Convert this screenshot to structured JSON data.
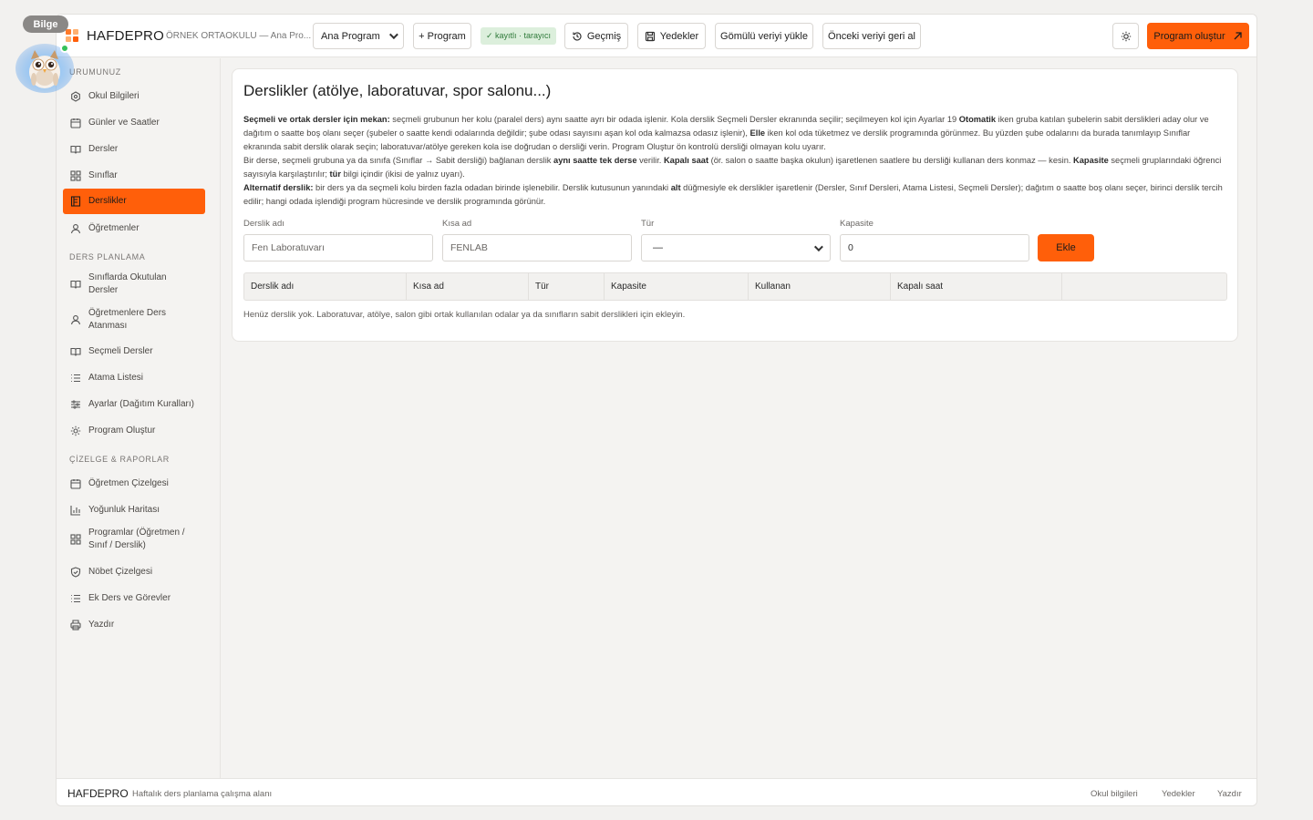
{
  "topbar": {
    "brand": "HAFDEPRO",
    "school": "ÖRNEK ORTAOKULU — Ana Pro...",
    "program_select": "Ana Program",
    "new_program": "+ Program",
    "status_badge": "✓ kayıtlı · tarayıcı",
    "history": "Geçmiş",
    "backups": "Yedekler",
    "load_embedded": "Gömülü veriyi yükle",
    "restore_previous": "Önceki veriyi geri al",
    "create_program": "Program oluştur"
  },
  "mascot": {
    "name": "Bilge"
  },
  "sidebar": {
    "section1": "URUMUNUZ",
    "items1": [
      {
        "label": "Okul Bilgileri",
        "icon": "gear-icon"
      },
      {
        "label": "Günler ve Saatler",
        "icon": "calendar-icon"
      },
      {
        "label": "Dersler",
        "icon": "book-icon"
      },
      {
        "label": "Sınıflar",
        "icon": "grid-icon"
      },
      {
        "label": "Derslikler",
        "icon": "room-icon"
      },
      {
        "label": "Öğretmenler",
        "icon": "user-icon"
      }
    ],
    "section2": "DERS PLANLAMA",
    "items2": [
      {
        "label": "Sınıflarda Okutulan Dersler",
        "icon": "book-icon"
      },
      {
        "label": "Öğretmenlere Ders Atanması",
        "icon": "user-icon"
      },
      {
        "label": "Seçmeli Dersler",
        "icon": "book-icon"
      },
      {
        "label": "Atama Listesi",
        "icon": "list-icon"
      },
      {
        "label": "Ayarlar (Dağıtım Kuralları)",
        "icon": "sliders-icon"
      },
      {
        "label": "Program Oluştur",
        "icon": "cog-icon"
      }
    ],
    "section3": "ÇİZELGE & RAPORLAR",
    "items3": [
      {
        "label": "Öğretmen Çizelgesi",
        "icon": "calendar-icon"
      },
      {
        "label": "Yoğunluk Haritası",
        "icon": "bar-chart-icon"
      },
      {
        "label": "Programlar (Öğretmen / Sınıf / Derslik)",
        "icon": "grid-icon"
      },
      {
        "label": "Nöbet Çizelgesi",
        "icon": "shield-icon"
      },
      {
        "label": "Ek Ders ve Görevler",
        "icon": "list-icon"
      },
      {
        "label": "Yazdır",
        "icon": "printer-icon"
      }
    ]
  },
  "main": {
    "title": "Derslikler (atölye, laboratuvar, spor salonu...)",
    "p1_bold": "Seçmeli ve ortak dersler için mekan:",
    "p1_a": " seçmeli grubunun her kolu (paralel ders) aynı saatte ayrı bir odada işlenir. Kola derslik Seçmeli Dersler ekranında seçilir; seçilmeyen kol için Ayarlar 19 ",
    "p1_b1": "Otomatik",
    "p1_b": " iken gruba katılan şubelerin sabit derslikleri aday olur ve dağıtım o saatte boş olanı seçer (şubeler o saatte kendi odalarında değildir; şube odası sayısını aşan kol oda kalmazsa odasız işlenir), ",
    "p1_b2": "Elle",
    "p1_c": " iken kol oda tüketmez ve derslik programında görünmez. Bu yüzden şube odalarını da burada tanımlayıp Sınıflar ekranında sabit derslik olarak seçin; laboratuvar/atölye gereken kola ise doğrudan o dersliği verin. Program Oluştur ön kontrolü dersliği olmayan kolu uyarır.",
    "p2_a": "Bir derse, seçmeli grubuna ya da sınıfa (Sınıflar → Sabit dersliği) bağlanan derslik ",
    "p2_b1": "aynı saatte tek derse",
    "p2_b": " verilir. ",
    "p2_b2": "Kapalı saat",
    "p2_c": " (ör. salon o saatte başka okulun) işaretlenen saatlere bu dersliği kullanan ders konmaz — kesin. ",
    "p2_b3": "Kapasite",
    "p2_d": " seçmeli gruplarındaki öğrenci sayısıyla karşılaştırılır; ",
    "p2_b4": "tür",
    "p2_e": " bilgi içindir (ikisi de yalnız uyarı).",
    "p3_bold": "Alternatif derslik:",
    "p3_a": " bir ders ya da seçmeli kolu birden fazla odadan birinde işlenebilir. Derslik kutusunun yanındaki ",
    "p3_b1": "alt",
    "p3_b": " düğmesiyle ek derslikler işaretlenir (Dersler, Sınıf Dersleri, Atama Listesi, Seçmeli Dersler); dağıtım o saatte boş olanı seçer, birinci derslik tercih edilir; hangi odada işlendiği program hücresinde ve derslik programında görünür.",
    "form": {
      "name_label": "Derslik adı",
      "name_placeholder": "Fen Laboratuvarı",
      "short_label": "Kısa ad",
      "short_placeholder": "FENLAB",
      "type_label": "Tür",
      "type_value": "—",
      "capacity_label": "Kapasite",
      "capacity_value": "0",
      "add_button": "Ekle"
    },
    "table_headers": [
      "Derslik adı",
      "Kısa ad",
      "Tür",
      "Kapasite",
      "Kullanan",
      "Kapalı saat",
      ""
    ],
    "empty_text": "Henüz derslik yok. Laboratuvar, atölye, salon gibi ortak kullanılan odalar ya da sınıfların sabit derslikleri için ekleyin."
  },
  "footer": {
    "brand": "HAFDEPRO",
    "tagline": "Haftalık ders planlama çalışma alanı",
    "links": [
      "Okul bilgileri",
      "Yedekler",
      "Yazdır"
    ]
  },
  "colors": {
    "accent": "#ff5f0a",
    "success_bg": "#dcefdc",
    "success_fg": "#2f7a3a"
  }
}
